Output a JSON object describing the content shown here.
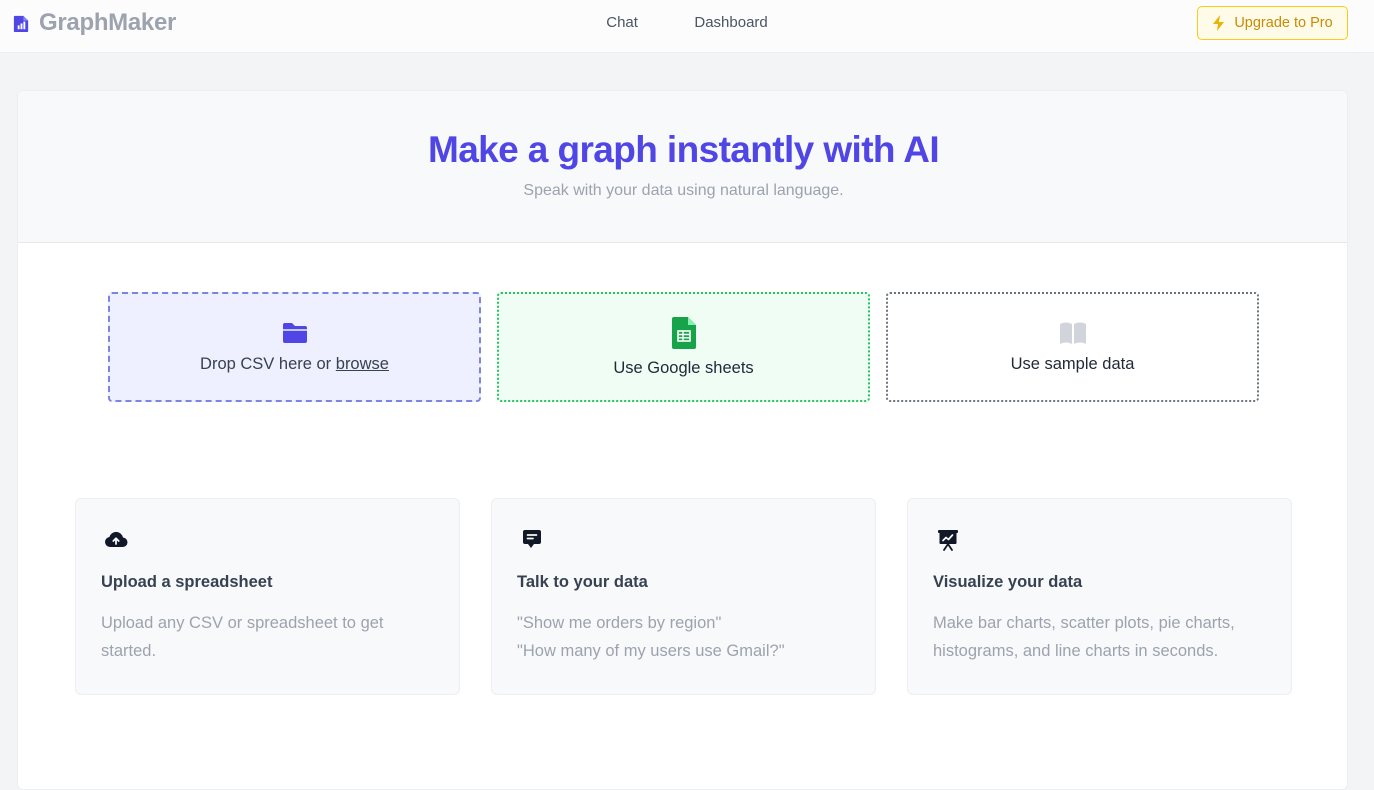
{
  "header": {
    "brand": "GraphMaker",
    "nav": [
      "Chat",
      "Dashboard"
    ],
    "upgrade_label": "Upgrade to Pro"
  },
  "hero": {
    "title": "Make a graph instantly with AI",
    "subtitle": "Speak with your data using natural language."
  },
  "sources": {
    "csv_prefix": "Drop CSV here or ",
    "csv_link": "browse",
    "google_sheets": "Use Google sheets",
    "sample": "Use sample data"
  },
  "features": [
    {
      "icon": "cloud-upload-icon",
      "title": "Upload a spreadsheet",
      "lines": [
        "Upload any CSV or spreadsheet to get started."
      ]
    },
    {
      "icon": "chat-bubble-icon",
      "title": "Talk to your data",
      "lines": [
        "\"Show me orders by region\"",
        "\"How many of my users use Gmail?\""
      ]
    },
    {
      "icon": "presentation-chart-icon",
      "title": "Visualize your data",
      "lines": [
        "Make bar charts, scatter plots, pie charts, histograms, and line charts in seconds."
      ]
    }
  ],
  "colors": {
    "brand": "#4f46e5",
    "upgrade": "#ca8a04",
    "sheets_green": "#16a34a"
  }
}
